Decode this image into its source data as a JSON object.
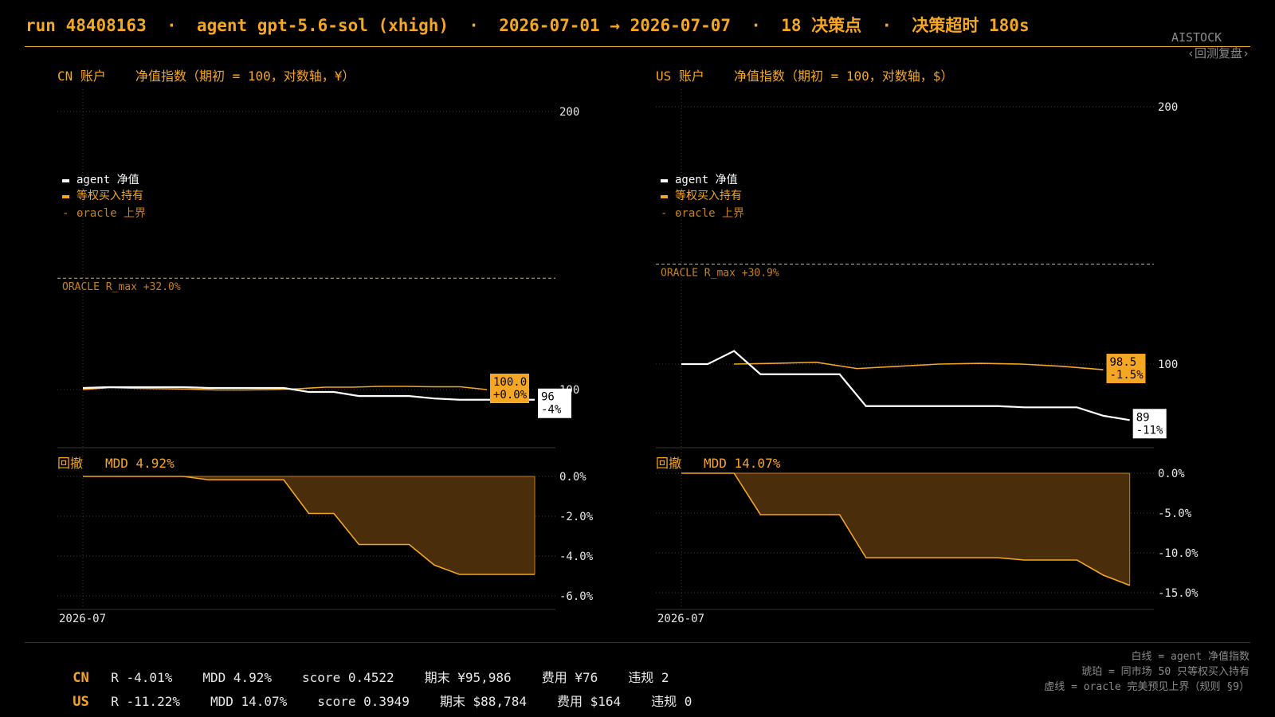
{
  "header": {
    "title": "run 48408163  ·  agent gpt-5.6-sol (xhigh)  ·  2026-07-01 → 2026-07-07  ·  18 决策点  ·  决策超时 180s",
    "brand": "AISTOCK",
    "back": "‹回测复盘›"
  },
  "legend": {
    "agent": "agent 净值",
    "bench": "等权买入持有",
    "oracle": "oracle 上界"
  },
  "footer": {
    "rows": [
      {
        "market": "CN",
        "items": [
          "R -4.01%",
          "MDD 4.92%",
          "score 0.4522",
          "期末 ¥95,986",
          "费用 ¥76",
          "违规 2"
        ]
      },
      {
        "market": "US",
        "items": [
          "R -11.22%",
          "MDD 14.07%",
          "score 0.3949",
          "期末 $88,784",
          "费用 $164",
          "违规 0"
        ]
      }
    ],
    "notes": [
      "白线 = agent 净值指数",
      "琥珀 = 同市场 50 只等权买入持有",
      "虚线 = oracle 完美预见上界（规则 §9）"
    ]
  },
  "colors": {
    "accent": "#f5a623",
    "agent": "#ffffff",
    "grid": "#3a3a3a",
    "muted": "#8a8a8a",
    "dd_fill": "#4a2d0a"
  },
  "chart_data": [
    {
      "type": "line",
      "account": "CN 账户",
      "title": "净值指数（期初 = 100，对数轴，¥）",
      "scale": "log",
      "ylim": [
        95,
        200
      ],
      "yticks": [
        "100",
        "200"
      ],
      "xtick": "2026-07",
      "oracle": {
        "value": 132.0,
        "label": "ORACLE R_max  +32.0%"
      },
      "series": [
        {
          "name": "agent 净值",
          "values": [
            100.4,
            100.6,
            100.6,
            100.6,
            100.6,
            100.4,
            100.4,
            100.4,
            100.4,
            99.4,
            99.4,
            98.4,
            98.4,
            98.4,
            97.8,
            97.5,
            97.5,
            97.5,
            97.5
          ]
        },
        {
          "name": "等权买入持有",
          "values": [
            100.0,
            100.5,
            100.3,
            100.2,
            100.1,
            99.9,
            99.9,
            100.0,
            100.2,
            100.6,
            100.6,
            100.8,
            100.8,
            100.7,
            100.7,
            100.0
          ]
        }
      ],
      "end_labels": {
        "bench": [
          "100.0",
          "+0.0%"
        ],
        "agent": [
          "96",
          "-4%"
        ]
      },
      "drawdown": {
        "label": "回撤",
        "mdd_text": "MDD 4.92%",
        "ylim": [
          -6.0,
          0.0
        ],
        "yticks": [
          "0.0%",
          "-2.0%",
          "-4.0%",
          "-6.0%"
        ],
        "values": [
          0.0,
          0.0,
          0.0,
          0.0,
          0.0,
          -0.17,
          -0.17,
          -0.17,
          -0.17,
          -1.86,
          -1.86,
          -3.42,
          -3.42,
          -3.42,
          -4.45,
          -4.92,
          -4.92,
          -4.92,
          -4.92
        ]
      }
    },
    {
      "type": "line",
      "account": "US 账户",
      "title": "净值指数（期初 = 100，对数轴，$）",
      "scale": "log",
      "ylim": [
        85,
        200
      ],
      "yticks": [
        "100",
        "200"
      ],
      "xtick": "2026-07",
      "oracle": {
        "value": 130.9,
        "label": "ORACLE R_max  +30.9%"
      },
      "series": [
        {
          "name": "agent 净值",
          "values": [
            100.0,
            100.0,
            103.6,
            97.3,
            97.3,
            97.3,
            97.3,
            89.3,
            89.3,
            89.3,
            89.3,
            89.3,
            89.3,
            89.0,
            89.0,
            89.0,
            87.0,
            86.0
          ]
        },
        {
          "name": "等权买入持有",
          "values": [
            100.0,
            100.2,
            100.5,
            98.8,
            99.4,
            100.0,
            100.2,
            100.0,
            99.4,
            98.5
          ]
        }
      ],
      "end_labels": {
        "bench": [
          "98.5",
          "-1.5%"
        ],
        "agent": [
          "89",
          "-11%"
        ]
      },
      "drawdown": {
        "label": "回撤",
        "mdd_text": "MDD 14.07%",
        "ylim": [
          -18.0,
          0.0
        ],
        "yticks": [
          "0.0%",
          "-5.0%",
          "-10.0%",
          "-15.0%"
        ],
        "values": [
          0.0,
          0.0,
          0.0,
          -5.2,
          -5.2,
          -5.2,
          -5.2,
          -10.6,
          -10.6,
          -10.6,
          -10.6,
          -10.6,
          -10.6,
          -10.9,
          -10.9,
          -10.9,
          -12.8,
          -14.07
        ]
      }
    }
  ]
}
